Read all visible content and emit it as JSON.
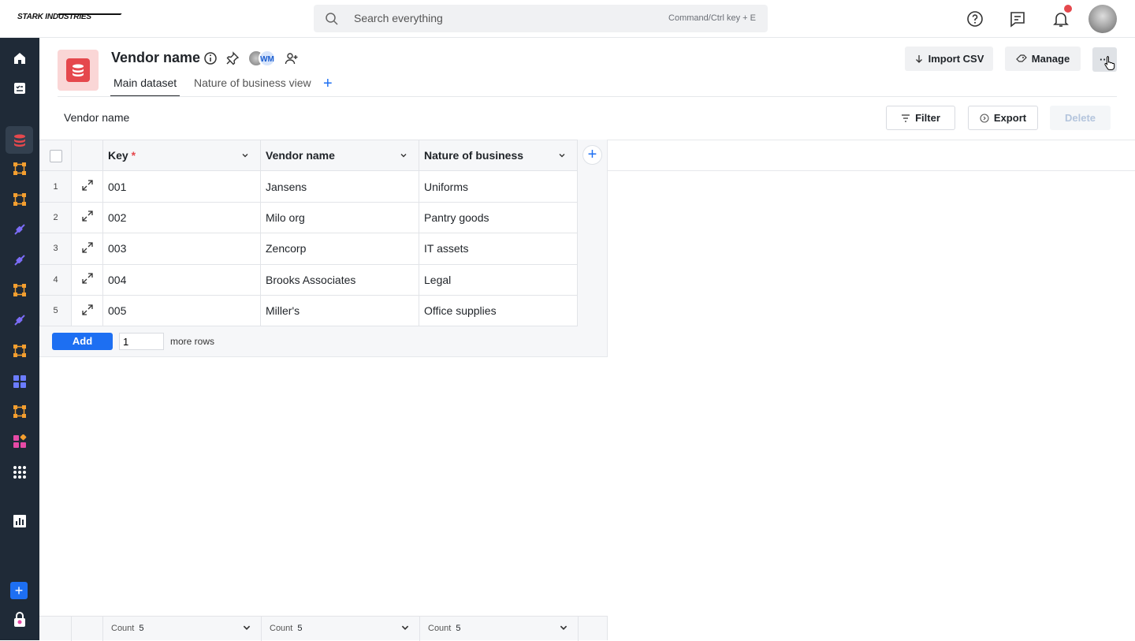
{
  "topbar": {
    "logo": "STARK INDUSTRIES",
    "search_placeholder": "Search everything",
    "search_hint": "Command/Ctrl key + E"
  },
  "sidebar": {
    "items": [
      "home-icon",
      "tasks-icon",
      "datasets-icon",
      "workflow-icon",
      "workflow-icon",
      "integration-icon",
      "integration-icon",
      "workflow-icon",
      "integration-icon",
      "workflow-icon",
      "apps-grid-icon",
      "workflow-icon",
      "app-store-icon",
      "all-apps-icon",
      "reports-icon"
    ],
    "active_index": 2,
    "colors": {
      "orange": "#f59f2f",
      "purple": "#7b6cf6",
      "blue": "#6b7cff",
      "pink": "#e64aa6"
    }
  },
  "header": {
    "title": "Vendor name",
    "collaborator_initials": "WM",
    "tabs": [
      {
        "label": "Main dataset",
        "selected": true
      },
      {
        "label": "Nature of business view",
        "selected": false
      }
    ],
    "import_label": "Import CSV",
    "manage_label": "Manage",
    "more_label": "···"
  },
  "view": {
    "label": "Vendor name",
    "filter_label": "Filter",
    "export_label": "Export",
    "delete_label": "Delete"
  },
  "table": {
    "columns": [
      {
        "label": "Key",
        "required": "*"
      },
      {
        "label": "Vendor name"
      },
      {
        "label": "Nature of business"
      }
    ],
    "rows": [
      {
        "n": "1",
        "key": "001",
        "vendor": "Jansens",
        "nature": "Uniforms"
      },
      {
        "n": "2",
        "key": "002",
        "vendor": "Milo org",
        "nature": "Pantry goods"
      },
      {
        "n": "3",
        "key": "003",
        "vendor": "Zencorp",
        "nature": "IT assets"
      },
      {
        "n": "4",
        "key": "004",
        "vendor": "Brooks Associates",
        "nature": "Legal"
      },
      {
        "n": "5",
        "key": "005",
        "vendor": "Miller's",
        "nature": "Office supplies"
      }
    ],
    "add_label": "Add",
    "add_count": "1",
    "more_rows_label": "more rows"
  },
  "footer": {
    "count_label": "Count",
    "counts": [
      "5",
      "5",
      "5"
    ]
  }
}
